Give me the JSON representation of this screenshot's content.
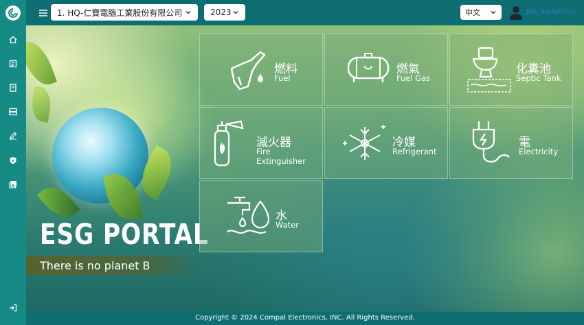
{
  "sidebar": {
    "logo_icon": "compal-logo-icon",
    "items": [
      "home-icon",
      "document-icon",
      "book-icon",
      "server-icon",
      "edit-icon",
      "shield-icon",
      "gallery-icon"
    ],
    "logout_icon": "logout-icon"
  },
  "header": {
    "company_select": "1. HQ-仁寶電腦工業股份有限公司",
    "year_select": "2023",
    "language_select": "中文",
    "username": "Jim_Sz(Admin)"
  },
  "hero": {
    "title": "ESG PORTAL",
    "tagline": "There is no planet B"
  },
  "tiles": [
    {
      "zh": "燃料",
      "en": "Fuel",
      "icon": "fuel-pump-icon"
    },
    {
      "zh": "燃氣",
      "en": "Fuel Gas",
      "icon": "gas-tank-icon"
    },
    {
      "zh": "化糞池",
      "en": "Septic Tank",
      "icon": "toilet-icon"
    },
    {
      "zh": "滅火器",
      "en": "Fire Extinguisher",
      "icon": "fire-extinguisher-icon"
    },
    {
      "zh": "冷媒",
      "en": "Refrigerant",
      "icon": "snowflake-icon"
    },
    {
      "zh": "電",
      "en": "Electricity",
      "icon": "plug-icon"
    },
    {
      "zh": "水",
      "en": "Water",
      "icon": "water-tap-icon"
    }
  ],
  "footer": {
    "copyright": "Copyright © 2024 Compal Electronics, INC. All Rights Reserved."
  }
}
